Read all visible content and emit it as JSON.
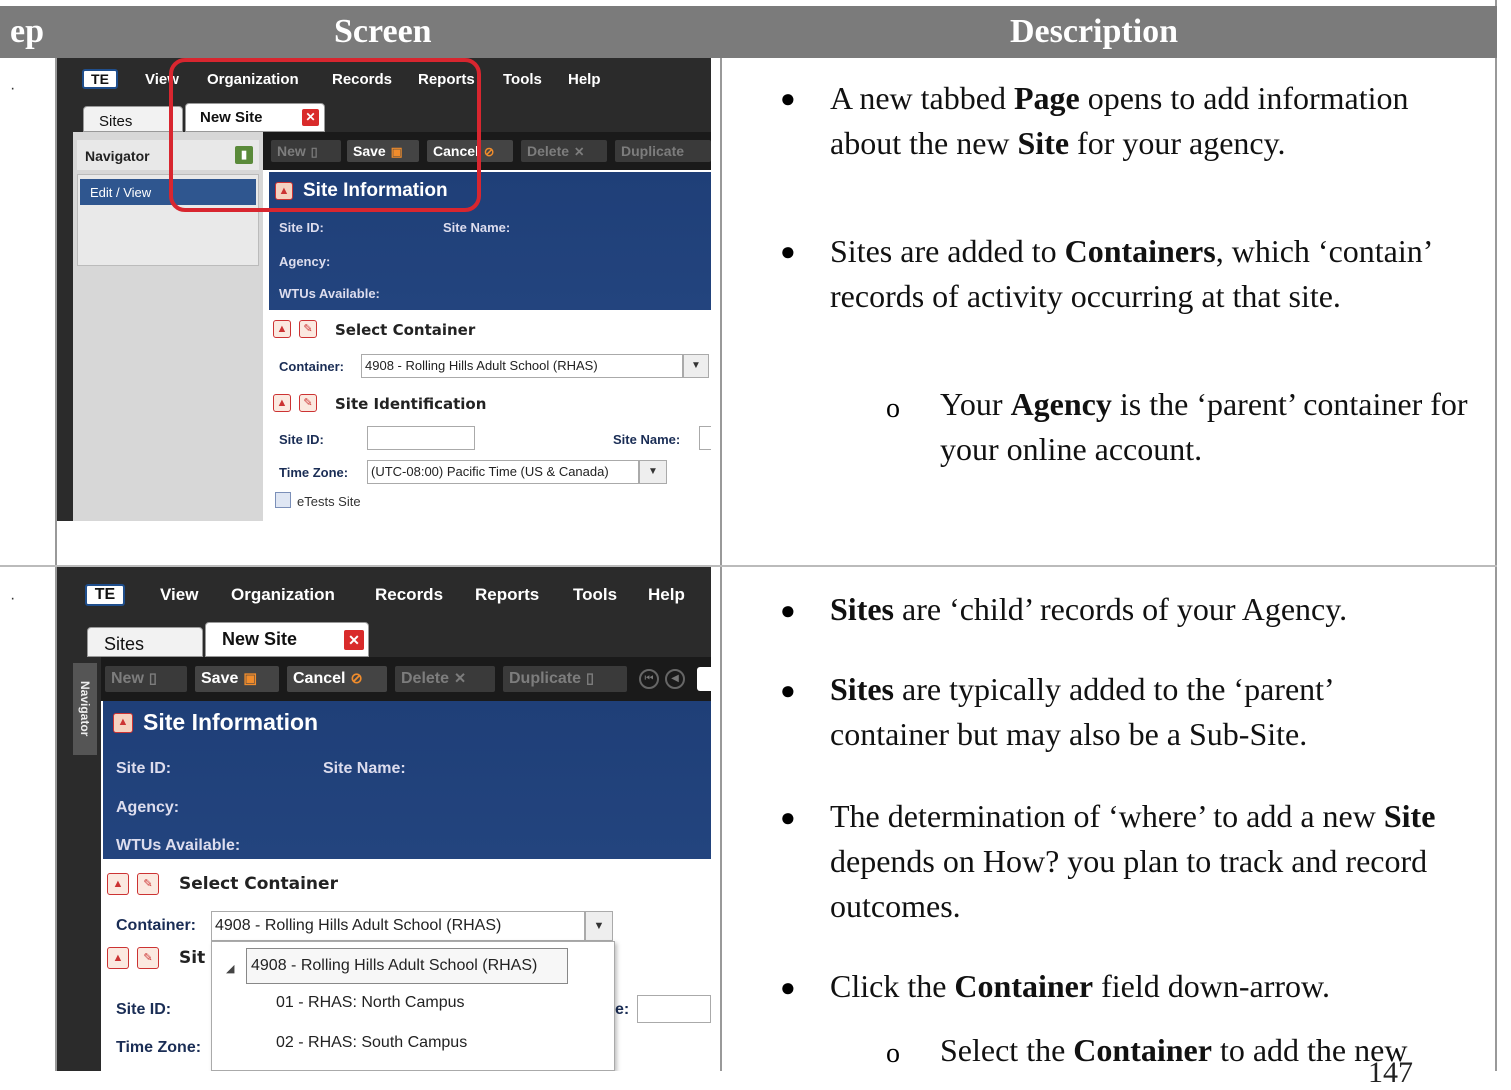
{
  "header": {
    "step": "ep",
    "screen": "Screen",
    "description": "Description"
  },
  "row1": {
    "step_mark": "·",
    "app": {
      "logo": "TE",
      "menu": [
        "View",
        "Organization",
        "Records",
        "Reports",
        "Tools",
        "Help"
      ],
      "tabs": {
        "sites": "Sites",
        "new_site": "New Site"
      },
      "navigator": {
        "title": "Navigator",
        "item": "Edit / View"
      },
      "toolbar": {
        "new": "New",
        "save": "Save",
        "cancel": "Cancel",
        "delete": "Delete",
        "duplicate": "Duplicate"
      },
      "site_info": {
        "title": "Site Information",
        "site_id": "Site ID:",
        "site_name": "Site Name:",
        "agency": "Agency:",
        "wtus": "WTUs Available:"
      },
      "select_container": {
        "title": "Select Container",
        "container_label": "Container:",
        "container_value": "4908 - Rolling Hills Adult School (RHAS)"
      },
      "site_identification": {
        "title": "Site Identification",
        "site_id": "Site ID:",
        "site_name": "Site Name:",
        "time_zone_label": "Time Zone:",
        "time_zone_value": "(UTC-08:00) Pacific Time (US & Canada)",
        "etests": "eTests Site"
      }
    },
    "bullets": [
      {
        "pre": "A new tabbed ",
        "b1": "Page",
        "mid": " opens to add information about the new ",
        "b2": "Site",
        "post": " for your agency."
      },
      {
        "pre": "Sites are added to ",
        "b1": "Containers",
        "post": ", which ‘contain’ records of activity occurring at that site."
      }
    ],
    "sub_bullet": {
      "pre": "Your ",
      "b1": "Agency",
      "post": " is the ‘parent’ container for your online account."
    }
  },
  "row2": {
    "step_mark": "·",
    "app": {
      "logo": "TE",
      "menu": [
        "View",
        "Organization",
        "Records",
        "Reports",
        "Tools",
        "Help"
      ],
      "tabs": {
        "sites": "Sites",
        "new_site": "New Site"
      },
      "navigator_label": "Navigator",
      "toolbar": {
        "new": "New",
        "save": "Save",
        "cancel": "Cancel",
        "delete": "Delete",
        "duplicate": "Duplicate"
      },
      "site_info": {
        "title": "Site Information",
        "site_id": "Site ID:",
        "site_name": "Site Name:",
        "agency": "Agency:",
        "wtus": "WTUs Available:"
      },
      "select_container": {
        "title": "Select Container",
        "container_label": "Container:",
        "container_value": "4908 - Rolling Hills Adult School (RHAS)"
      },
      "site_identification": {
        "title_partial": "Sit",
        "site_id": "Site ID:",
        "site_name_partial": "e:",
        "time_zone_label": "Time Zone:"
      },
      "dropdown": {
        "selected": "4908 - Rolling Hills Adult School (RHAS)",
        "items": [
          "01 - RHAS: North Campus",
          "02 - RHAS: South Campus"
        ]
      }
    },
    "bullets": [
      {
        "b1": "Sites",
        "post": " are ‘child’ records of your Agency."
      },
      {
        "b1": "Sites",
        "post": " are typically added to the ‘parent’ container but may also be a Sub-Site."
      },
      {
        "pre": "The determination of ‘where’ to add a new ",
        "b1": "Site",
        "post": " depends on How? you plan to track and record outcomes."
      },
      {
        "pre": "Click the ",
        "b1": "Container",
        "post": " field down-arrow."
      }
    ],
    "sub_bullet": {
      "pre": "Select the ",
      "b1": "Container",
      "post": " to add the new"
    }
  },
  "page_number": "147"
}
